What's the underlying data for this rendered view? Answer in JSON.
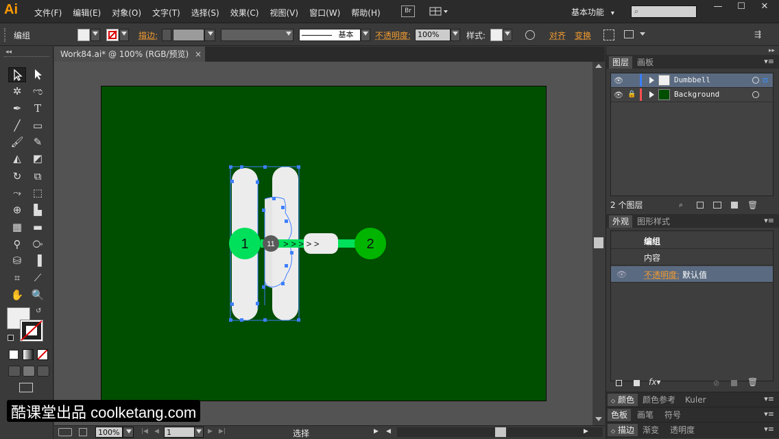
{
  "app": {
    "logo": "Ai",
    "bridge": "Br",
    "workspace": "基本功能",
    "workspace_arrow": "▾",
    "search_icon": "⌕"
  },
  "menu": [
    "文件(F)",
    "编辑(E)",
    "对象(O)",
    "文字(T)",
    "选择(S)",
    "效果(C)",
    "视图(V)",
    "窗口(W)",
    "帮助(H)"
  ],
  "window_buttons": [
    "—",
    "☐",
    "✕"
  ],
  "control": {
    "selection_type": "编组",
    "stroke_label": "描边:",
    "stroke_style": "基本",
    "opacity_label": "不透明度:",
    "opacity_value": "100%",
    "style_label": "样式:",
    "align_label": "对齐",
    "transform_label": "变换"
  },
  "document": {
    "tab_title": "Work84.ai* @ 100% (RGB/预览)",
    "tab_close": "×"
  },
  "artwork": {
    "artboard_color": "#004e00",
    "badge_1": "1",
    "badge_2": "2",
    "badge_11": "11",
    "arrows": "> > > > >",
    "accent_green": "#00e05a",
    "dark_green_circle": "#00b400"
  },
  "status": {
    "zoom": "100%",
    "page": "1",
    "mode": "选择"
  },
  "layers_panel": {
    "tabs": [
      "图层",
      "画板"
    ],
    "rows": [
      {
        "name": "Dumbbell",
        "color": "#3a7fff",
        "thumb": "#f0f0f0"
      },
      {
        "name": "Background",
        "color": "#ff5050",
        "thumb": "#004e00"
      }
    ],
    "count_label": "2 个图层"
  },
  "appearance_panel": {
    "tabs": [
      "外观",
      "图形样式"
    ],
    "title": "编组",
    "content_label": "内容",
    "opacity_label": "不透明度:",
    "opacity_value": "默认值"
  },
  "bottom_tabs": {
    "row1": [
      "颜色",
      "颜色参考",
      "Kuler"
    ],
    "row2": [
      "色板",
      "画笔",
      "符号"
    ],
    "row3": [
      "描边",
      "渐变",
      "透明度"
    ]
  },
  "watermark": "酷课堂出品 coolketang.com"
}
